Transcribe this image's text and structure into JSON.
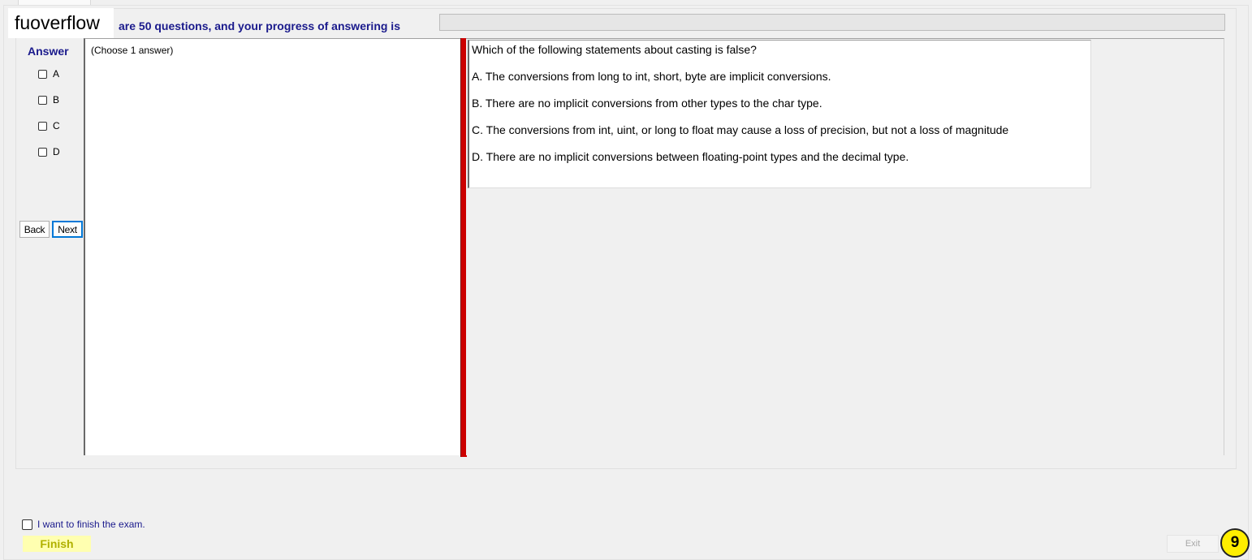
{
  "watermark": "fuoverflow",
  "header": {
    "progress_text": "are 50 questions, and your progress of answering is",
    "progress_fraction": 0
  },
  "answer_panel": {
    "title": "Answer",
    "options": [
      "A",
      "B",
      "C",
      "D"
    ],
    "back_label": "Back",
    "next_label": "Next"
  },
  "instruction": "(Choose 1 answer)",
  "question": {
    "text": "Which of the following statements about casting is false?",
    "choices": [
      "A.  The conversions from long to int, short, byte are implicit conversions.",
      "B.  There are no implicit conversions from other types to the char type.",
      "C.  The conversions from int, uint, or long to float may cause a loss of precision, but not a loss of magnitude",
      "D.  There are no implicit conversions between floating-point types and the decimal type."
    ]
  },
  "footer": {
    "finish_checkbox_label": "I want to finish the exam.",
    "finish_label": "Finish",
    "exit_label": "Exit",
    "badge": "9"
  },
  "colors": {
    "accent_text": "#1a1a8c",
    "splitter": "#cc0000",
    "finish_bg": "#ffffb0",
    "badge_bg": "#ffee00"
  }
}
